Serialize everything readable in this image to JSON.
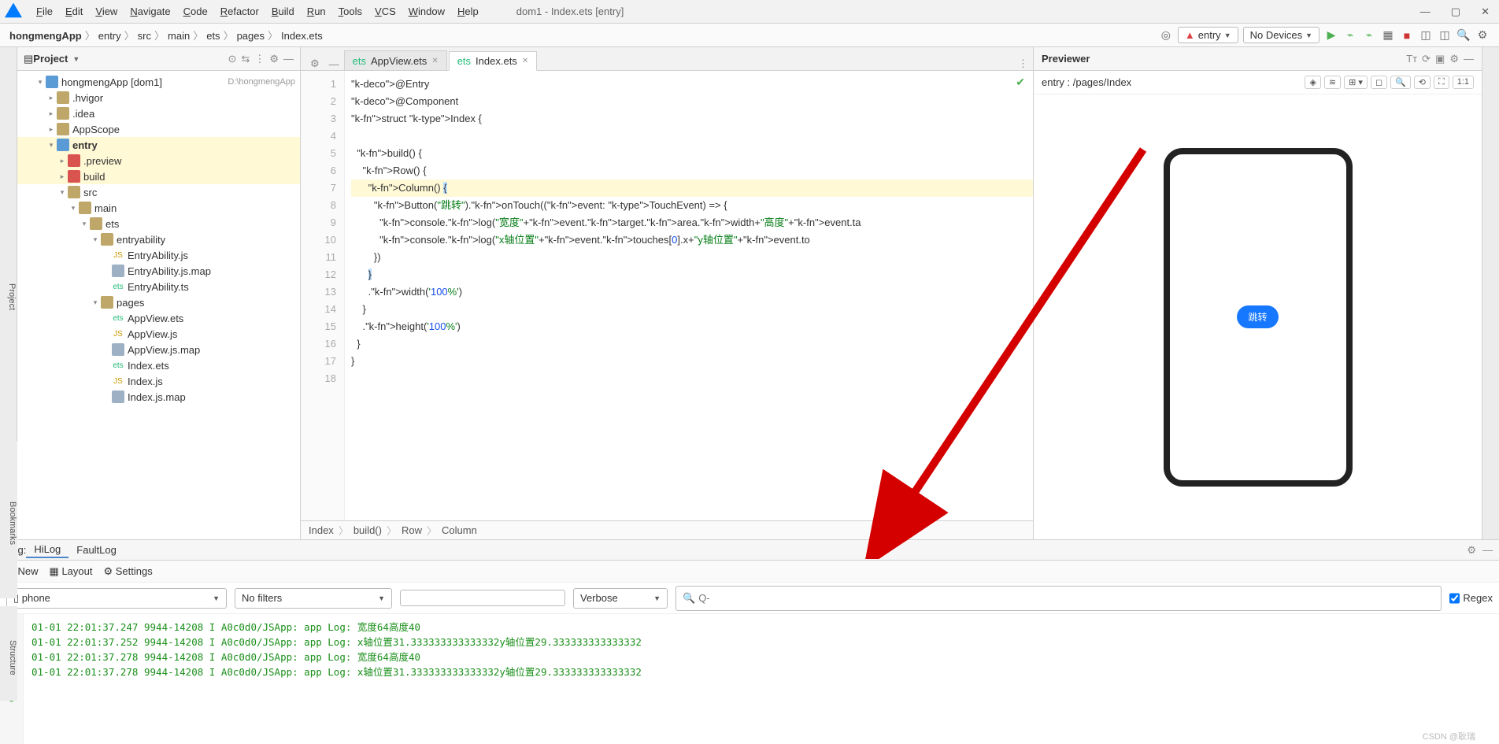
{
  "window": {
    "title": "dom1 - Index.ets [entry]",
    "menu": [
      "File",
      "Edit",
      "View",
      "Navigate",
      "Code",
      "Refactor",
      "Build",
      "Run",
      "Tools",
      "VCS",
      "Window",
      "Help"
    ]
  },
  "nav": {
    "crumbs": [
      "hongmengApp",
      "entry",
      "src",
      "main",
      "ets",
      "pages",
      "Index.ets"
    ],
    "module": "entry",
    "device": "No Devices"
  },
  "project": {
    "title": "Project",
    "root_label": "hongmengApp [dom1]",
    "root_path": "D:\\hongmengApp",
    "tree": [
      {
        "d": 1,
        "exp": "▾",
        "ic": "folder-blue",
        "label": "hongmengApp [dom1]",
        "extra": "D:\\hongmengApp"
      },
      {
        "d": 2,
        "exp": "▸",
        "ic": "folder",
        "label": ".hvigor"
      },
      {
        "d": 2,
        "exp": "▸",
        "ic": "folder",
        "label": ".idea"
      },
      {
        "d": 2,
        "exp": "▸",
        "ic": "folder",
        "label": "AppScope"
      },
      {
        "d": 2,
        "exp": "▾",
        "ic": "folder-blue",
        "label": "entry",
        "hl": true,
        "bold": true
      },
      {
        "d": 3,
        "exp": "▸",
        "ic": "folder-red",
        "label": ".preview",
        "hl": true
      },
      {
        "d": 3,
        "exp": "▸",
        "ic": "folder-red",
        "label": "build",
        "hl": true
      },
      {
        "d": 3,
        "exp": "▾",
        "ic": "folder",
        "label": "src"
      },
      {
        "d": 4,
        "exp": "▾",
        "ic": "folder",
        "label": "main"
      },
      {
        "d": 5,
        "exp": "▾",
        "ic": "folder",
        "label": "ets"
      },
      {
        "d": 6,
        "exp": "▾",
        "ic": "folder",
        "label": "entryability"
      },
      {
        "d": 7,
        "exp": "",
        "ic": "js",
        "label": "EntryAbility.js"
      },
      {
        "d": 7,
        "exp": "",
        "ic": "file",
        "label": "EntryAbility.js.map"
      },
      {
        "d": 7,
        "exp": "",
        "ic": "ets",
        "label": "EntryAbility.ts"
      },
      {
        "d": 6,
        "exp": "▾",
        "ic": "folder",
        "label": "pages"
      },
      {
        "d": 7,
        "exp": "",
        "ic": "ets",
        "label": "AppView.ets"
      },
      {
        "d": 7,
        "exp": "",
        "ic": "js",
        "label": "AppView.js"
      },
      {
        "d": 7,
        "exp": "",
        "ic": "file",
        "label": "AppView.js.map"
      },
      {
        "d": 7,
        "exp": "",
        "ic": "ets",
        "label": "Index.ets"
      },
      {
        "d": 7,
        "exp": "",
        "ic": "js",
        "label": "Index.js"
      },
      {
        "d": 7,
        "exp": "",
        "ic": "file",
        "label": "Index.js.map"
      }
    ]
  },
  "tabs": {
    "items": [
      {
        "label": "AppView.ets",
        "active": false
      },
      {
        "label": "Index.ets",
        "active": true
      }
    ]
  },
  "code": {
    "lines": [
      "@Entry",
      "@Component",
      "struct Index {",
      "",
      "  build() {",
      "    Row() {",
      "      Column() {",
      "        Button(\"跳转\").onTouch((event: TouchEvent) => {",
      "          console.log(\"宽度\"+event.target.area.width+\"高度\"+event.ta",
      "          console.log(\"x轴位置\"+event.touches[0].x+\"y轴位置\"+event.to",
      "        })",
      "      }",
      "      .width('100%')",
      "    }",
      "    .height('100%')",
      "  }",
      "}",
      ""
    ],
    "breadcrumb": [
      "Index",
      "build()",
      "Row",
      "Column"
    ]
  },
  "previewer": {
    "title": "Previewer",
    "entry": "entry : /pages/Index",
    "button": "跳转"
  },
  "log": {
    "tabs_label": "Log:",
    "tabs": [
      "HiLog",
      "FaultLog"
    ],
    "active_tab": "HiLog",
    "toolbar": {
      "new": "New",
      "layout": "Layout",
      "settings": "Settings"
    },
    "filters": {
      "device": "phone",
      "filter": "No filters",
      "level": "Verbose",
      "regex": "Regex",
      "search_placeholder": "Q-"
    },
    "lines": [
      "01-01 22:01:37.247 9944-14208 I A0c0d0/JSApp: app Log: 宽度64高度40",
      "01-01 22:01:37.252 9944-14208 I A0c0d0/JSApp: app Log: x轴位置31.333333333333332y轴位置29.333333333333332",
      "01-01 22:01:37.278 9944-14208 I A0c0d0/JSApp: app Log: 宽度64高度40",
      "01-01 22:01:37.278 9944-14208 I A0c0d0/JSApp: app Log: x轴位置31.333333333333332y轴位置29.333333333333332"
    ]
  },
  "watermark": "CSDN @耿瑞"
}
